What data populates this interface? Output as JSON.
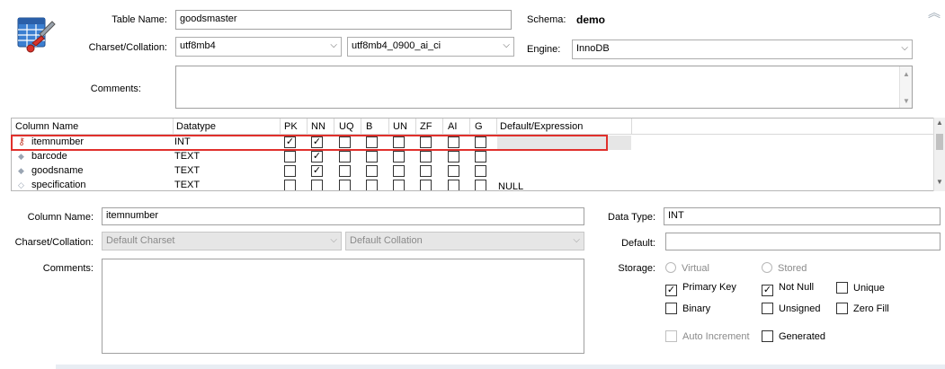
{
  "table": {
    "name_label": "Table Name:",
    "name_value": "goodsmaster",
    "schema_label": "Schema:",
    "schema_value": "demo",
    "charset_label": "Charset/Collation:",
    "charset_value": "utf8mb4",
    "collation_value": "utf8mb4_0900_ai_ci",
    "engine_label": "Engine:",
    "engine_value": "InnoDB",
    "comments_label": "Comments:",
    "comments_value": ""
  },
  "grid": {
    "headers": [
      "Column Name",
      "Datatype",
      "PK",
      "NN",
      "UQ",
      "B",
      "UN",
      "ZF",
      "AI",
      "G",
      "Default/Expression"
    ],
    "rows": [
      {
        "name": "itemnumber",
        "icon": "key-icon",
        "datatype": "INT",
        "flags": [
          true,
          true,
          false,
          false,
          false,
          false,
          false,
          false
        ],
        "default": "",
        "selected": true
      },
      {
        "name": "barcode",
        "icon": "diamond-icon",
        "datatype": "TEXT",
        "flags": [
          false,
          true,
          false,
          false,
          false,
          false,
          false,
          false
        ],
        "default": "",
        "selected": false
      },
      {
        "name": "goodsname",
        "icon": "diamond-icon",
        "datatype": "TEXT",
        "flags": [
          false,
          true,
          false,
          false,
          false,
          false,
          false,
          false
        ],
        "default": "",
        "selected": false
      },
      {
        "name": "specification",
        "icon": "diamond-outline-icon",
        "datatype": "TEXT",
        "flags": [
          false,
          false,
          false,
          false,
          false,
          false,
          false,
          false
        ],
        "default": "NULL",
        "selected": false
      }
    ]
  },
  "column": {
    "name_label": "Column Name:",
    "name_value": "itemnumber",
    "charset_label": "Charset/Collation:",
    "charset_value": "Default Charset",
    "collation_value": "Default Collation",
    "comments_label": "Comments:",
    "comments_value": "",
    "datatype_label": "Data Type:",
    "datatype_value": "INT",
    "default_label": "Default:",
    "default_value": "",
    "storage_label": "Storage:",
    "virtual_label": "Virtual",
    "stored_label": "Stored",
    "primary_key_label": "Primary Key",
    "not_null_label": "Not Null",
    "unique_label": "Unique",
    "binary_label": "Binary",
    "unsigned_label": "Unsigned",
    "zero_fill_label": "Zero Fill",
    "auto_increment_label": "Auto Increment",
    "generated_label": "Generated",
    "primary_key_checked": true,
    "not_null_checked": true,
    "unique_checked": false,
    "binary_checked": false,
    "unsigned_checked": false,
    "zero_fill_checked": false,
    "auto_increment_checked": false,
    "generated_checked": false
  },
  "colors": {
    "highlight": "#e0302c",
    "selected_row": "#e6e6e6",
    "disabled_field": "#e6e6e6"
  }
}
